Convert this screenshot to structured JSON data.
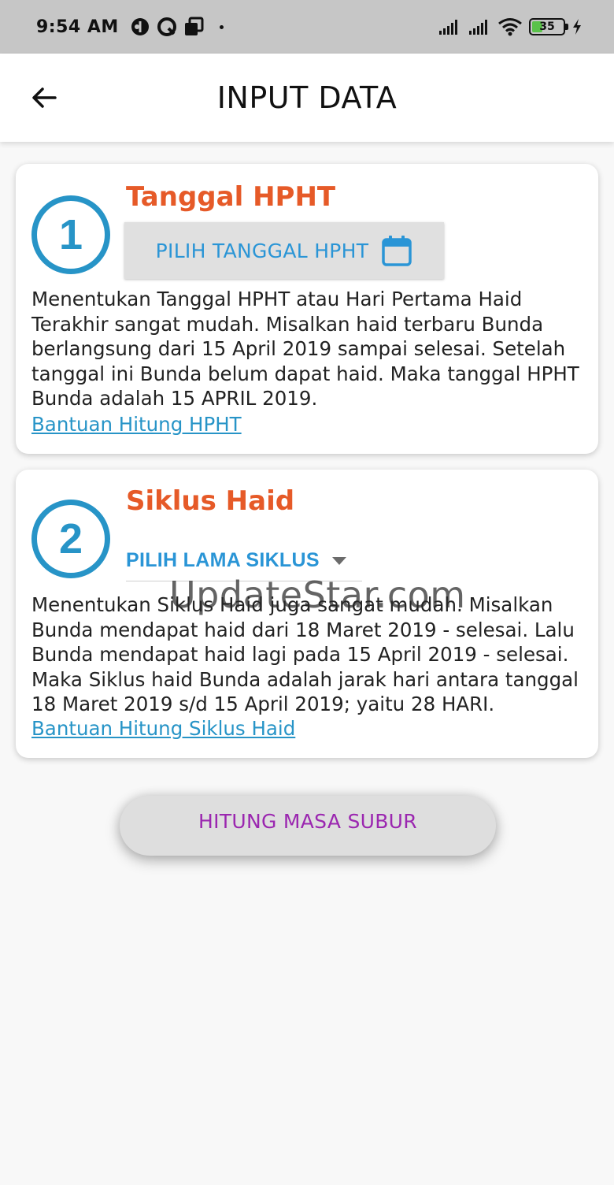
{
  "status_bar": {
    "time": "9:54 AM",
    "battery": "35",
    "icons": [
      "app-icon-1",
      "app-icon-2",
      "app-icon-3",
      "signal-icon",
      "signal-icon",
      "wifi-icon",
      "battery-icon",
      "charging-icon"
    ]
  },
  "app_bar": {
    "title": "INPUT DATA"
  },
  "card_hpht": {
    "step": "1",
    "title": "Tanggal HPHT",
    "button_label": "PILIH TANGGAL HPHT",
    "description": "Menentukan Tanggal HPHT atau Hari Pertama Haid Terakhir sangat mudah. Misalkan haid terbaru Bunda berlangsung dari 15 April 2019 sampai selesai. Setelah tanggal ini Bunda belum dapat haid. Maka tanggal HPHT Bunda adalah 15 APRIL 2019.",
    "help_link": "Bantuan Hitung HPHT"
  },
  "card_siklus": {
    "step": "2",
    "title": "Siklus Haid",
    "dropdown_label": "PILIH LAMA SIKLUS",
    "description": "Menentukan Siklus Haid juga sangat mudah. Misalkan Bunda mendapat haid dari 18 Maret 2019 - selesai. Lalu Bunda mendapat haid lagi pada 15 April 2019 - selesai. Maka Siklus haid Bunda adalah jarak hari antara tanggal 18 Maret 2019 s/d 15 April 2019; yaitu 28 HARI.",
    "help_link": "Bantuan Hitung Siklus Haid"
  },
  "main_button": {
    "label": "HITUNG MASA SUBUR"
  },
  "watermark": "UpdateStar.com",
  "colors": {
    "accent_blue": "#2794c7",
    "title_orange": "#e65a28",
    "button_purple": "#9b27b0"
  }
}
